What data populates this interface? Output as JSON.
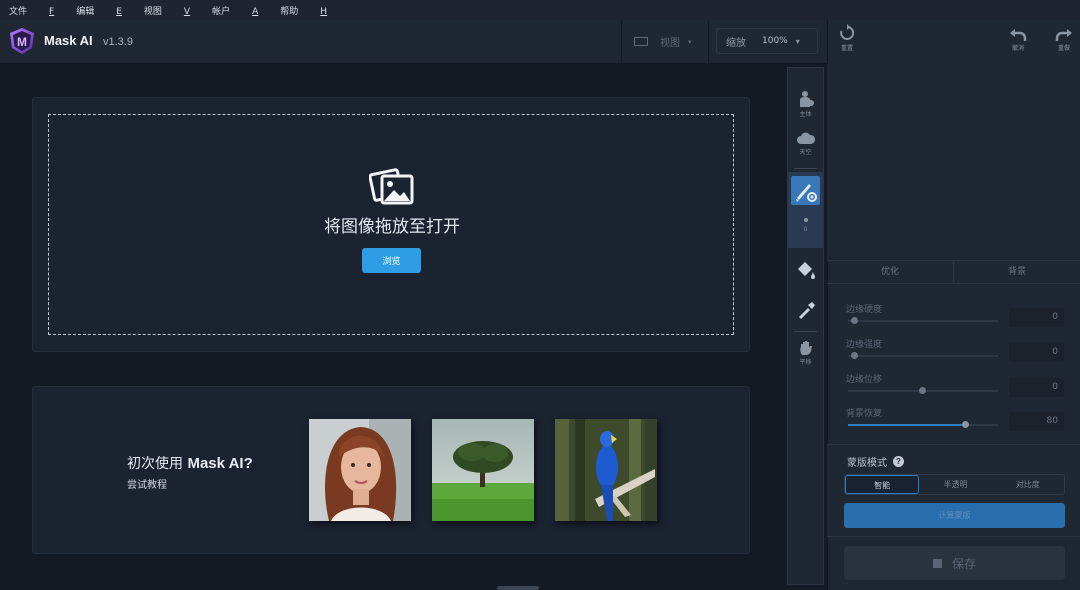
{
  "menu": [
    {
      "label": "文件",
      "key": "F"
    },
    {
      "label": "编辑",
      "key": "E"
    },
    {
      "label": "视图",
      "key": "V"
    },
    {
      "label": "帐户",
      "key": "A"
    },
    {
      "label": "帮助",
      "key": "H"
    }
  ],
  "app": {
    "name": "Mask AI",
    "version": "v1.3.9",
    "logo_letter": "M"
  },
  "header": {
    "view_label": "视图",
    "zoom_label": "缩放",
    "zoom_value": "100%"
  },
  "right_header": {
    "reset": "重置",
    "undo": "撤消",
    "redo": "重做"
  },
  "drop": {
    "text": "将图像拖放至打开",
    "browse": "浏览"
  },
  "tutorial": {
    "title_prefix": "初次使用 ",
    "title_brand": "Mask AI?",
    "subtitle": "尝试教程"
  },
  "tools": {
    "subject": "主体",
    "sky": "天空",
    "brush_size": "0",
    "pan": "平移"
  },
  "tabs": [
    "优化",
    "背景"
  ],
  "sliders": [
    {
      "label": "边缘硬度",
      "value": "0",
      "fraction": 0.0
    },
    {
      "label": "边缘强度",
      "value": "0",
      "fraction": 0.0
    },
    {
      "label": "边缘位移",
      "value": "0",
      "fraction": 0.5
    },
    {
      "label": "背景恢复",
      "value": "80",
      "fraction": 0.8
    }
  ],
  "mask_mode": {
    "title": "蒙版模式",
    "options": [
      "智能",
      "半透明",
      "对比度"
    ],
    "selected": "智能",
    "compute": "计算蒙版"
  },
  "save": {
    "label": "保存"
  },
  "colors": {
    "accent": "#2f9de6",
    "background": "#151b25",
    "panel": "#1f2733"
  }
}
